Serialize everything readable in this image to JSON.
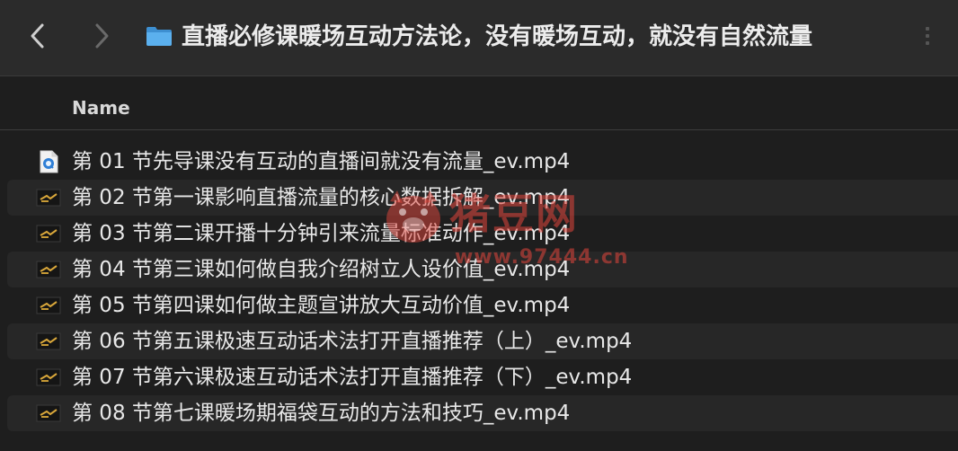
{
  "window": {
    "title": "直播必修课暖场互动方法论，没有暖场互动，就没有自然流量"
  },
  "toolbar": {
    "back_icon": "chevron-left-icon",
    "forward_icon": "chevron-right-icon",
    "folder_icon": "folder-icon",
    "folder_color": "#4ea6e6"
  },
  "columns": {
    "name": "Name"
  },
  "files": [
    {
      "name": "第 01 节先导课没有互动的直播间就没有流量_ev.mp4",
      "icon": "quicktime-file-icon"
    },
    {
      "name": "第 02 节第一课影响直播流量的核心数据拆解_ev.mp4",
      "icon": "video-thumbnail-icon"
    },
    {
      "name": "第 03 节第二课开播十分钟引来流量标准动作_ev.mp4",
      "icon": "video-thumbnail-icon"
    },
    {
      "name": "第 04 节第三课如何做自我介绍树立人设价值_ev.mp4",
      "icon": "video-thumbnail-icon"
    },
    {
      "name": "第 05 节第四课如何做主题宣讲放大互动价值_ev.mp4",
      "icon": "video-thumbnail-icon"
    },
    {
      "name": "第 06 节第五课极速互动话术法打开直播推荐（上）_ev.mp4",
      "icon": "video-thumbnail-icon"
    },
    {
      "name": "第 07 节第六课极速互动话术法打开直播推荐（下）_ev.mp4",
      "icon": "video-thumbnail-icon"
    },
    {
      "name": "第 08 节第七课暖场期福袋互动的方法和技巧_ev.mp4",
      "icon": "video-thumbnail-icon"
    }
  ],
  "watermark": {
    "text": "猪豆网",
    "url": "www.97444.cn",
    "logo_icon": "pig-logo-icon",
    "color": "#e1463c"
  }
}
